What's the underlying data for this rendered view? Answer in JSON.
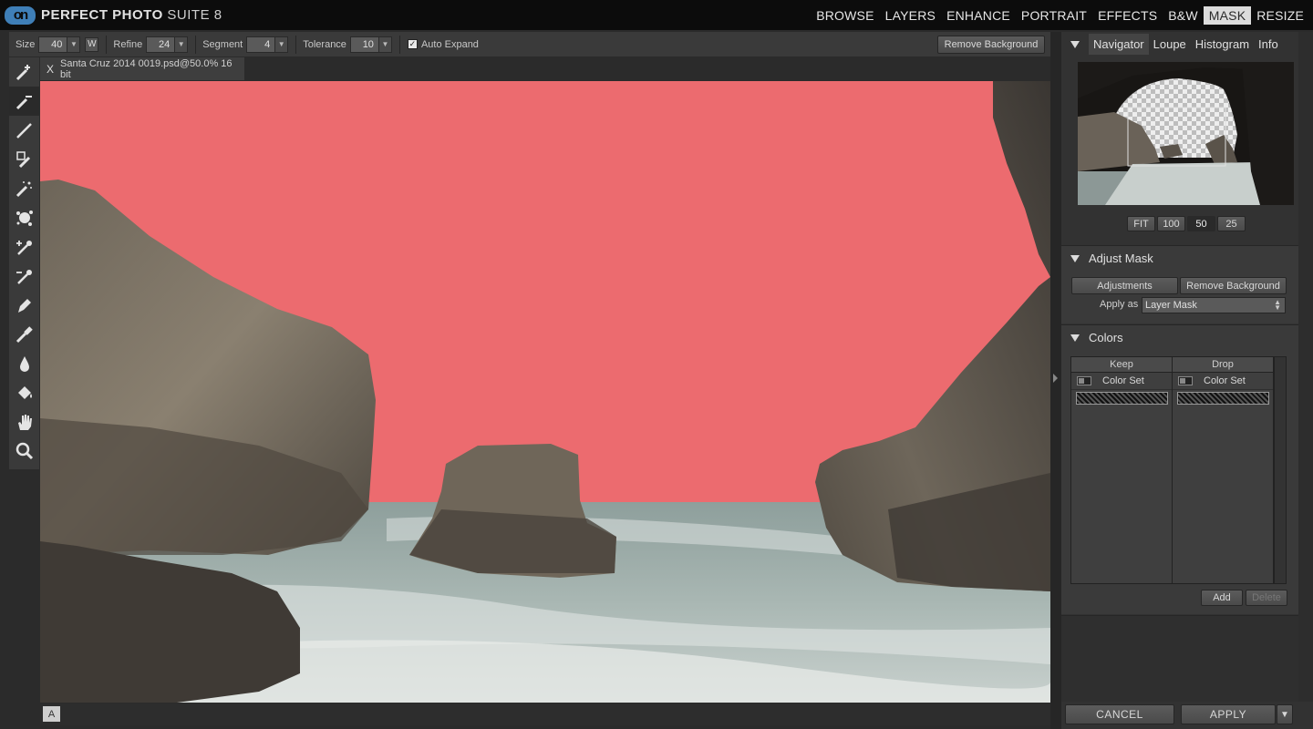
{
  "app": {
    "logo_mark": "on",
    "name_bold": "PERFECT PHOTO",
    "name_thin": " SUITE 8"
  },
  "modules": [
    "BROWSE",
    "LAYERS",
    "ENHANCE",
    "PORTRAIT",
    "EFFECTS",
    "B&W",
    "MASK",
    "RESIZE"
  ],
  "active_module": "MASK",
  "options": {
    "size_label": "Size",
    "size_value": "40",
    "w_label": "W",
    "refine_label": "Refine",
    "refine_value": "24",
    "segment_label": "Segment",
    "segment_value": "4",
    "tolerance_label": "Tolerance",
    "tolerance_value": "10",
    "auto_expand_label": "Auto Expand",
    "auto_expand_checked": true,
    "remove_background_label": "Remove Background"
  },
  "tools": [
    "keep-brush-icon",
    "drop-brush-icon",
    "mask-brush-icon",
    "magic-brush-icon",
    "color-keep-icon",
    "splat-icon",
    "keep-eyedropper-icon",
    "drop-eyedropper-icon",
    "pen-icon",
    "chisel-icon",
    "blur-drop-icon",
    "bucket-icon",
    "hand-icon",
    "zoom-icon"
  ],
  "document": {
    "close": "X",
    "tab_title": "Santa Cruz 2014 0019.psd@50.0% 16 bit"
  },
  "status": {
    "layer_indicator": "A"
  },
  "navigator": {
    "tabs": [
      "Navigator",
      "Loupe",
      "Histogram",
      "Info"
    ],
    "active_tab": "Navigator",
    "zoom_buttons": [
      "FIT",
      "100",
      "50",
      "25"
    ],
    "active_zoom": "50"
  },
  "adjust_mask": {
    "title": "Adjust Mask",
    "adjustments_label": "Adjustments",
    "remove_background_label": "Remove Background",
    "apply_as_label": "Apply as",
    "apply_as_value": "Layer Mask"
  },
  "colors": {
    "title": "Colors",
    "keep_header": "Keep",
    "drop_header": "Drop",
    "keep_row": "Color Set",
    "drop_row": "Color Set",
    "add_label": "Add",
    "delete_label": "Delete"
  },
  "footer": {
    "cancel_label": "CANCEL",
    "apply_label": "APPLY"
  },
  "colors_palette": {
    "mask_overlay": "#ec6b6f",
    "accent_logo": "#3f7fb8"
  }
}
